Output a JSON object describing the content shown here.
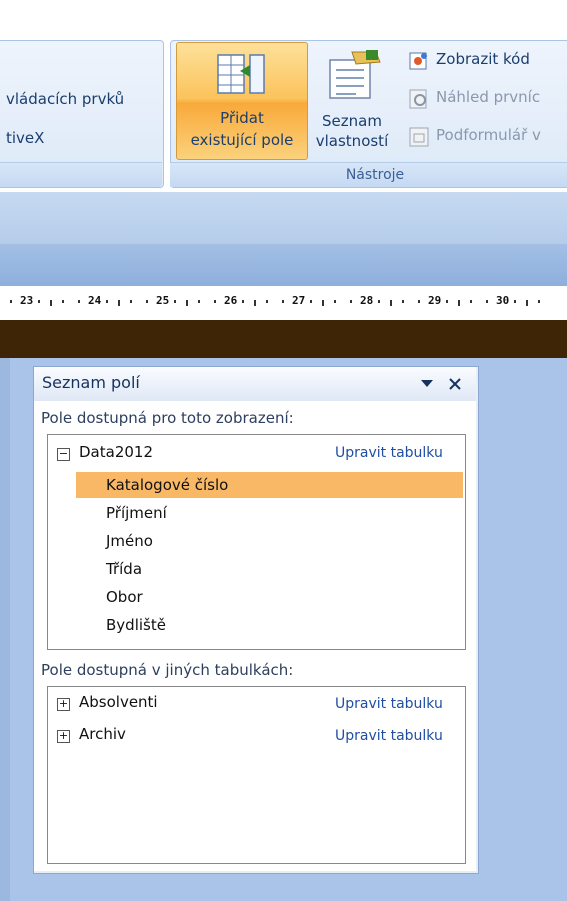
{
  "ribbon": {
    "left_group": {
      "line1": "vládacích prvků",
      "line2": "tiveX"
    },
    "tools_group": {
      "label": "Nástroje",
      "add_existing_fields": {
        "line1": "Přidat",
        "line2": "existující pole"
      },
      "property_sheet": {
        "line1": "Seznam",
        "line2": "vlastností"
      },
      "view_code": "Zobrazit kód",
      "preview_first": "Náhled prvníc",
      "subform": "Podformulář v"
    }
  },
  "ruler": {
    "ticks": [
      "23",
      "24",
      "25",
      "26",
      "27",
      "28",
      "29",
      "30"
    ]
  },
  "field_list": {
    "title": "Seznam polí",
    "available_label": "Pole dostupná pro toto zobrazení:",
    "table": {
      "name": "Data2012",
      "edit_link": "Upravit tabulku",
      "fields": [
        "Katalogové číslo",
        "Příjmení",
        "Jméno",
        "Třída",
        "Obor",
        "Bydliště"
      ],
      "selected_index": 0
    },
    "other_label": "Pole dostupná v jiných tabulkách:",
    "other_tables": [
      {
        "name": "Absolventi",
        "edit_link": "Upravit tabulku"
      },
      {
        "name": "Archiv",
        "edit_link": "Upravit tabulku"
      }
    ]
  },
  "colors": {
    "selection": "#f8b866",
    "link": "#1f4ea3",
    "brown_bar": "#3d2506"
  }
}
